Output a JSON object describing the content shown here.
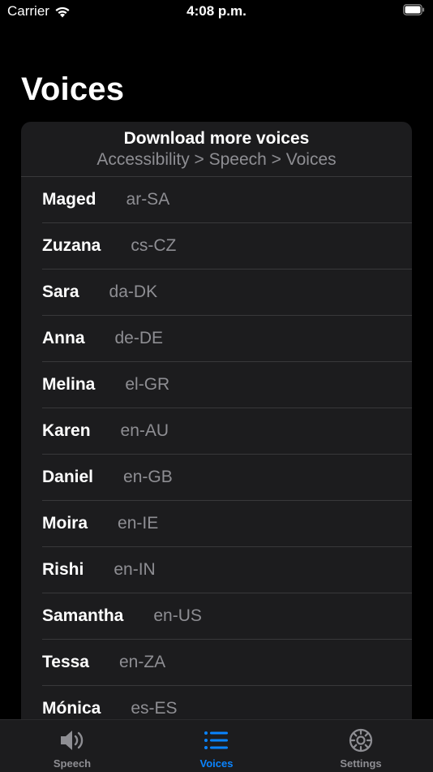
{
  "status_bar": {
    "carrier": "Carrier",
    "time": "4:08 p.m."
  },
  "page": {
    "title": "Voices"
  },
  "download": {
    "title": "Download more voices",
    "path": "Accessibility > Speech > Voices"
  },
  "voices": [
    {
      "name": "Maged",
      "lang": "ar-SA"
    },
    {
      "name": "Zuzana",
      "lang": "cs-CZ"
    },
    {
      "name": "Sara",
      "lang": "da-DK"
    },
    {
      "name": "Anna",
      "lang": "de-DE"
    },
    {
      "name": "Melina",
      "lang": "el-GR"
    },
    {
      "name": "Karen",
      "lang": "en-AU"
    },
    {
      "name": "Daniel",
      "lang": "en-GB"
    },
    {
      "name": "Moira",
      "lang": "en-IE"
    },
    {
      "name": "Rishi",
      "lang": "en-IN"
    },
    {
      "name": "Samantha",
      "lang": "en-US"
    },
    {
      "name": "Tessa",
      "lang": "en-ZA"
    },
    {
      "name": "Mónica",
      "lang": "es-ES"
    }
  ],
  "tabs": [
    {
      "label": "Speech",
      "icon": "speaker-icon",
      "active": false
    },
    {
      "label": "Voices",
      "icon": "list-icon",
      "active": true
    },
    {
      "label": "Settings",
      "icon": "gear-icon",
      "active": false
    }
  ],
  "colors": {
    "background": "#000000",
    "card": "#1c1c1e",
    "secondary_text": "#8e8e93",
    "accent": "#0a84ff",
    "separator": "#38383a"
  }
}
